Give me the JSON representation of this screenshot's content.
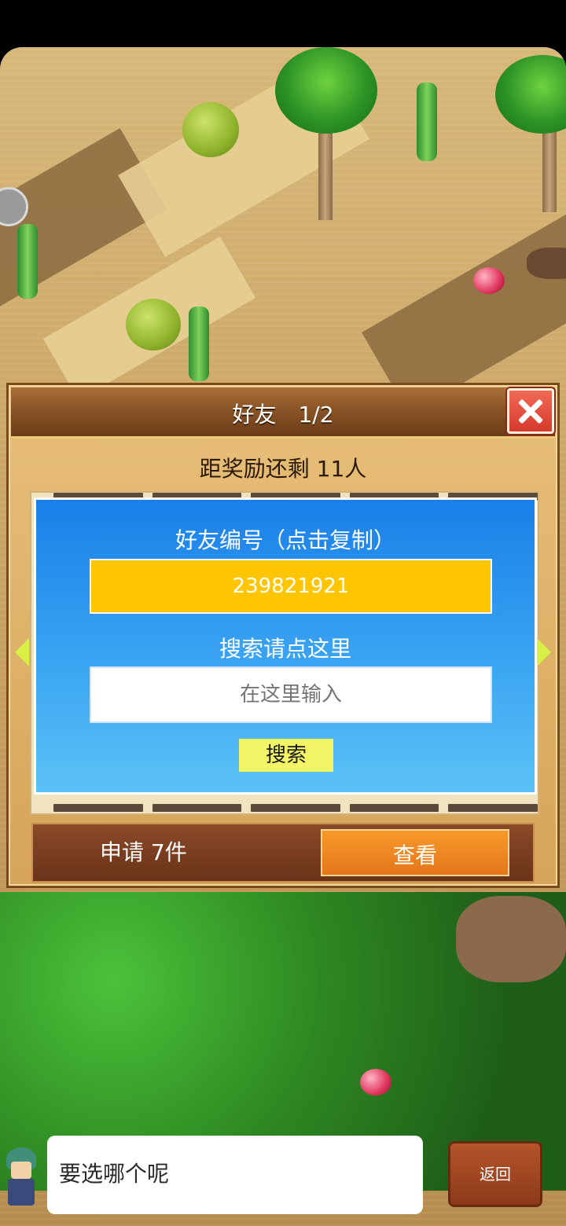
{
  "dialog": {
    "title": "好友　1/2",
    "reward_text": "距奖励还剩 11人",
    "friend_id_label": "好友编号（点击复制）",
    "friend_id": "239821921",
    "search_label": "搜索请点这里",
    "search_placeholder": "在这里输入",
    "search_button": "搜索",
    "apply_text": "申请 7件",
    "view_button": "查看"
  },
  "chat": {
    "message": "要选哪个呢",
    "back_button": "返回"
  },
  "icons": {
    "close": "close-icon",
    "prev": "arrow-left-icon",
    "next": "arrow-right-icon"
  }
}
